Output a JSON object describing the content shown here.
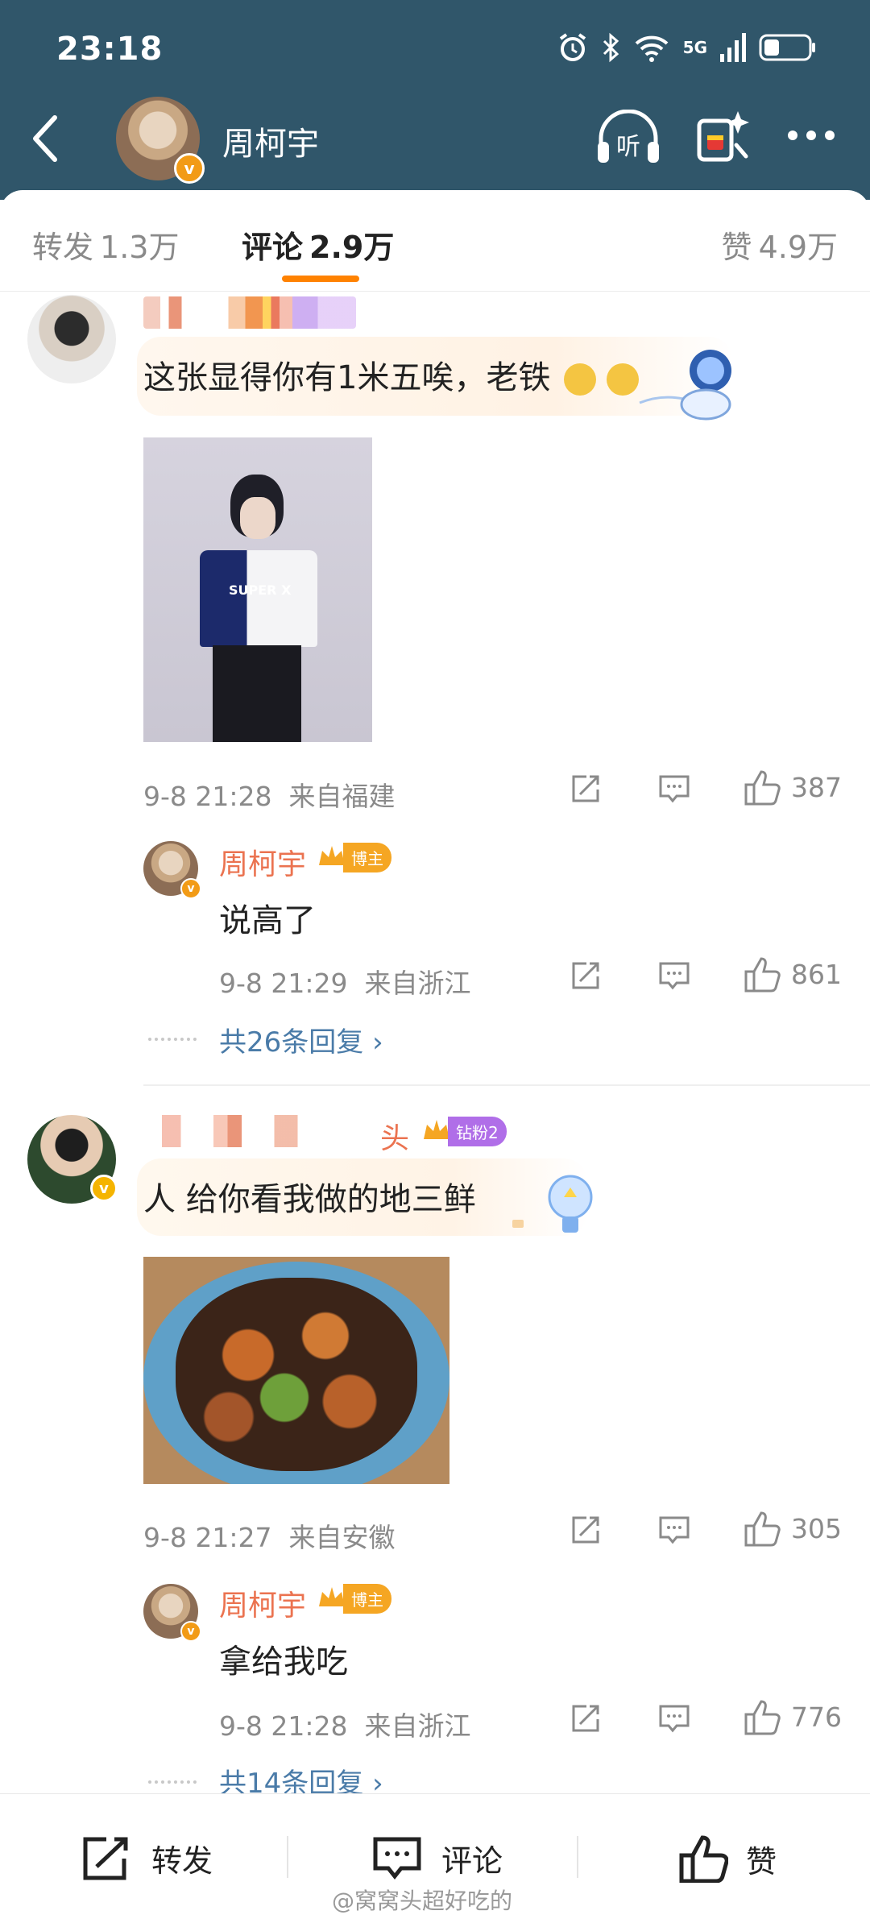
{
  "status_bar": {
    "time": "23:18",
    "network": "5G"
  },
  "nav": {
    "title": "周柯宇",
    "back_icon": "back-arrow-icon",
    "listen_icon": "headphones-icon",
    "listen_label": "听",
    "gift_icon": "gift-icon",
    "more_icon": "more-icon"
  },
  "tabs": [
    {
      "label": "转发",
      "count": "1.3万"
    },
    {
      "label": "评论",
      "count": "2.9万"
    },
    {
      "label": "赞",
      "count": "4.9万"
    }
  ],
  "comments": [
    {
      "text": "这张显得你有1米五唉，老铁",
      "time": "9-8 21:28",
      "location": "来自福建",
      "likes": "387",
      "reply": {
        "name": "周柯宇",
        "badge": "博主",
        "text": "说高了",
        "time": "9-8 21:29",
        "location": "来自浙江",
        "likes": "861"
      },
      "more_replies": "共26条回复 ›"
    },
    {
      "name_suffix": "头",
      "badge": "钻粉2",
      "text": "人 给你看我做的地三鲜",
      "time": "9-8 21:27",
      "location": "来自安徽",
      "likes": "305",
      "reply": {
        "name": "周柯宇",
        "badge": "博主",
        "text": "拿给我吃",
        "time": "9-8 21:28",
        "location": "来自浙江",
        "likes": "776"
      },
      "more_replies": "共14条回复 ›"
    }
  ],
  "photo1": {
    "shirt_text": "SUPER X"
  },
  "bottom_bar": {
    "repost": "转发",
    "comment": "评论",
    "like": "赞"
  },
  "watermark": "@窝窝头超好吃的",
  "colors": {
    "header": "#30566a",
    "accent": "#ff8200",
    "link": "#4a7ba8",
    "username": "#eb7350"
  }
}
